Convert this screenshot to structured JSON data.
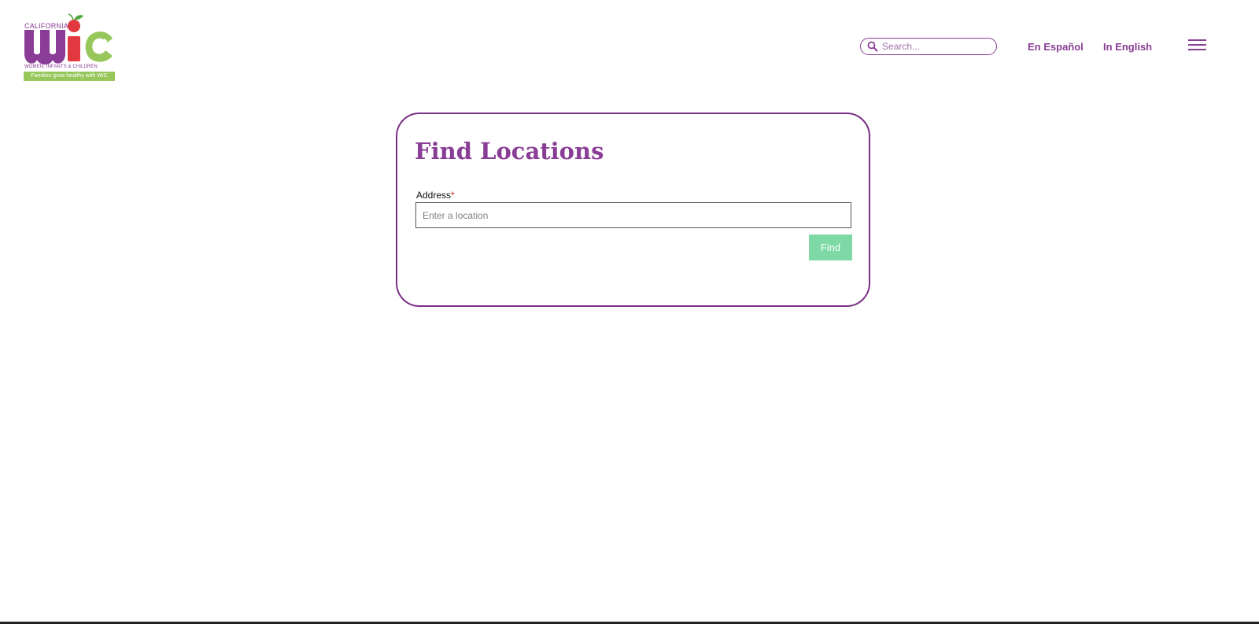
{
  "logo": {
    "state": "CALIFORNIA",
    "program": "WIC",
    "subtitle": "WOMEN, INFANTS & CHILDREN",
    "tagline": "Families grow healthy with WIC",
    "colors": {
      "purple": "#8a3d96",
      "red": "#e2383f",
      "green": "#97c75a",
      "leaf": "#4fa83d"
    }
  },
  "header": {
    "search": {
      "placeholder": "Search...",
      "value": "",
      "icon": "search-icon"
    },
    "languages": {
      "spanish_label": "En Español",
      "english_label": "In English"
    },
    "menu_icon": "hamburger-menu-icon"
  },
  "card": {
    "title": "Find Locations",
    "address_label": "Address",
    "required_marker": "*",
    "address_placeholder": "Enter a location",
    "address_value": "",
    "find_label": "Find"
  },
  "theme": {
    "accent": "#8a3d96",
    "card_border": "#7b2f86",
    "button": "#7fd9a6",
    "required": "#c0282d"
  }
}
